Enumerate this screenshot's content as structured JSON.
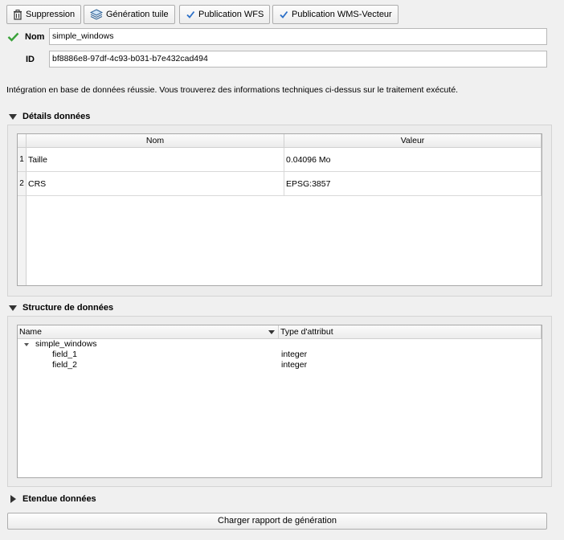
{
  "toolbar": {
    "suppression_label": "Suppression",
    "generation_tuile_label": "Génération tuile",
    "publication_wfs_label": "Publication WFS",
    "publication_wms_label": "Publication WMS-Vecteur"
  },
  "form": {
    "nom_label": "Nom",
    "nom_value": "simple_windows",
    "id_label": "ID",
    "id_value": "bf8886e8-97df-4c93-b031-b7e432cad494"
  },
  "message": "Intégration en base de données réussie. Vous trouverez des informations techniques ci-dessus sur le traitement exécuté.",
  "details": {
    "title": "Détails données",
    "columns": [
      "Nom",
      "Valeur"
    ],
    "rows": [
      {
        "num": "1",
        "nom": "Taille",
        "valeur": "0.04096 Mo"
      },
      {
        "num": "2",
        "nom": "CRS",
        "valeur": "EPSG:3857"
      }
    ]
  },
  "structure": {
    "title": "Structure de données",
    "columns": [
      "Name",
      "Type d'attribut"
    ],
    "root": "simple_windows",
    "fields": [
      {
        "name": "field_1",
        "type": "integer"
      },
      {
        "name": "field_2",
        "type": "integer"
      }
    ]
  },
  "etendue": {
    "title": "Etendue données"
  },
  "report_button_label": "Charger rapport de génération",
  "colors": {
    "check_green": "#3aa23a",
    "tick_blue": "#2b6fc7"
  },
  "icons": [
    "trash-icon",
    "layers-icon",
    "checkbox-checked-icon",
    "check-icon",
    "triangle-down-icon",
    "triangle-right-icon"
  ]
}
